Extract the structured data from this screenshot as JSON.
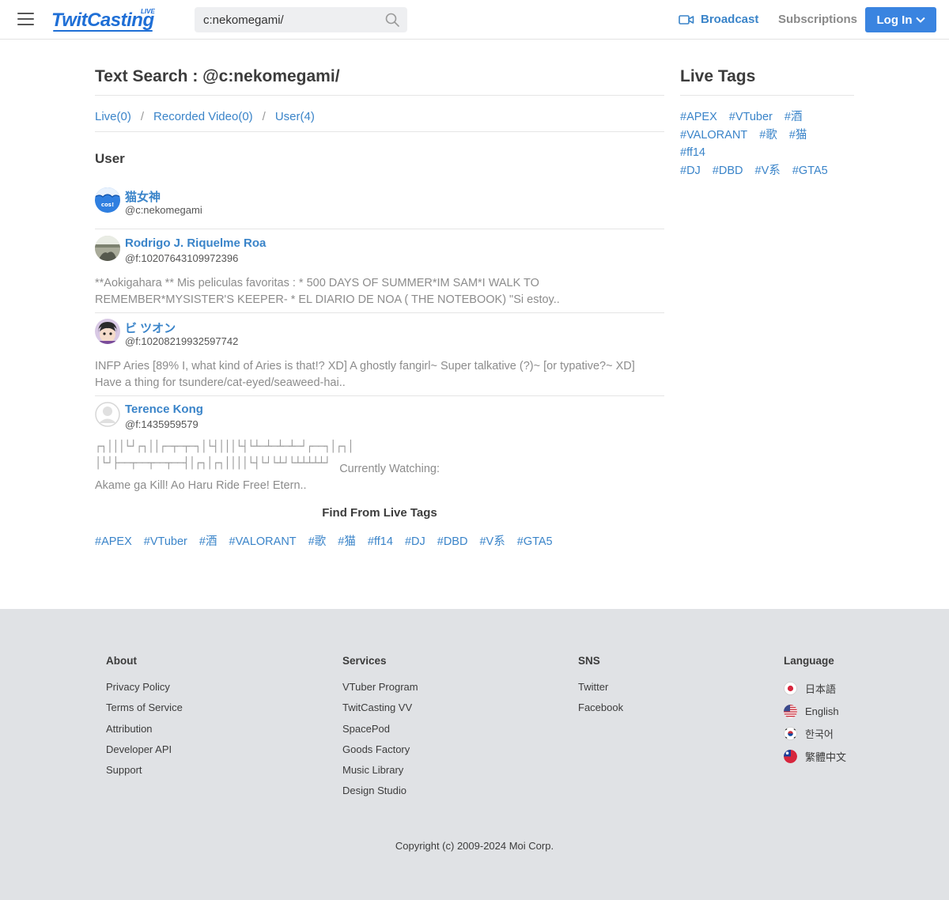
{
  "header": {
    "logo": "TwitCasting",
    "logo_badge": "LIVE",
    "search_value": "c:nekomegami/",
    "broadcast_label": "Broadcast",
    "subscriptions_label": "Subscriptions",
    "login_label": "Log In"
  },
  "main": {
    "title": "Text Search : @c:nekomegami/",
    "tabs": [
      {
        "label": "Live(0)"
      },
      {
        "label": "Recorded Video(0)"
      },
      {
        "label": "User(4)"
      }
    ],
    "tab_separator": "/",
    "section_heading": "User",
    "users": [
      {
        "name": "猫女神",
        "id": "@c:nekomegami",
        "avatar_text": "cos!",
        "bio": ""
      },
      {
        "name": "Rodrigo J. Riquelme Roa",
        "id": "@f:10207643109972396",
        "bio": "**Aokigahara ** Mis peliculas favoritas : * 500 DAYS OF SUMMER*IM SAM*I WALK TO REMEMBER*MYSISTER'S KEEPER- * EL DIARIO DE NOA ( THE NOTEBOOK) \"Si estoy.."
      },
      {
        "name": "ビ ツオン",
        "id": "@f:10208219932597742",
        "bio": "INFP Aries [89% I, what kind of Aries is that!? XD] A ghostly fangirl~ Super talkative (?)~ [or typative?~ XD] Have a thing for tsundere/cat-eyed/seaweed-hai.."
      },
      {
        "name": "Terence Kong",
        "id": "@f:1435959579",
        "bio_art_line1": "┌┐│││└┘┌┐││┌─┬─┬─┐│└┤│││└┤└┴─┴─┴─┴─┘┌──┐│┌┐│",
        "bio_art_line2": "│└┘├──┬──┬──┬──┤│┌┐│┌┐││││└┤└┘└┴┘└┴┴┴┴┴┘",
        "bio_tail": "Currently Watching:",
        "bio_last": "Akame ga Kill! Ao Haru Ride Free! Etern.."
      }
    ],
    "find_heading": "Find From Live Tags",
    "bottom_tags": [
      "#APEX",
      "#VTuber",
      "#酒",
      "#VALORANT",
      "#歌",
      "#猫",
      "#ff14",
      "#DJ",
      "#DBD",
      "#V系",
      "#GTA5"
    ]
  },
  "sidebar": {
    "title": "Live Tags",
    "tags": [
      "#APEX",
      "#VTuber",
      "#酒",
      "#VALORANT",
      "#歌",
      "#猫",
      "#ff14",
      "#DJ",
      "#DBD",
      "#V系",
      "#GTA5"
    ]
  },
  "footer": {
    "about": {
      "heading": "About",
      "links": [
        "Privacy Policy",
        "Terms of Service",
        "Attribution",
        "Developer API",
        "Support"
      ]
    },
    "services": {
      "heading": "Services",
      "links": [
        "VTuber Program",
        "TwitCasting VV",
        "SpacePod",
        "Goods Factory",
        "Music Library",
        "Design Studio"
      ]
    },
    "sns": {
      "heading": "SNS",
      "links": [
        "Twitter",
        "Facebook"
      ]
    },
    "language": {
      "heading": "Language",
      "items": [
        {
          "label": "日本語",
          "flag": "japan-flag-icon"
        },
        {
          "label": "English",
          "flag": "us-flag-icon"
        },
        {
          "label": "한국어",
          "flag": "korea-flag-icon"
        },
        {
          "label": "繁體中文",
          "flag": "taiwan-flag-icon"
        }
      ]
    },
    "copyright": "Copyright (c) 2009-2024 Moi Corp."
  },
  "colors": {
    "link": "#3a84c9",
    "brand": "#1f6fd6",
    "login_button": "#3a84e0",
    "footer_bg": "#e0e2e5"
  }
}
